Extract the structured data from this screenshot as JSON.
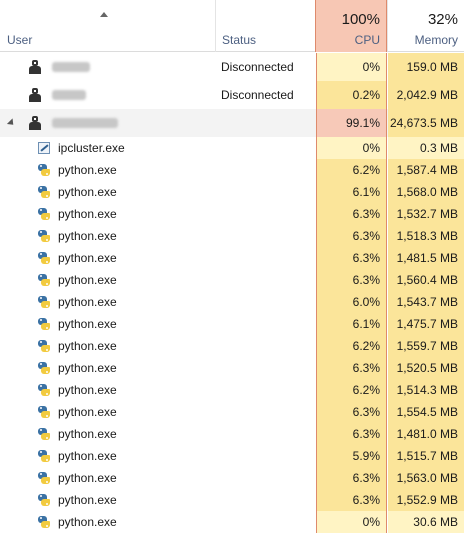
{
  "header": {
    "user_label": "User",
    "status_label": "Status",
    "cpu_pct": "100%",
    "cpu_label": "CPU",
    "mem_pct": "32%",
    "mem_label": "Memory"
  },
  "colors": {
    "cpu_header_bg": "#f7c7b4",
    "cpu_border": "#de8a6c",
    "heat_low": "#fff4c4",
    "heat_mid": "#fbe59a",
    "heat_high": "#f7c9b8",
    "header_label": "#4d6082"
  },
  "users": [
    {
      "name": "",
      "status": "Disconnected",
      "cpu": "0%",
      "memory": "159.0 MB",
      "blur_width": 38
    },
    {
      "name": "",
      "status": "Disconnected",
      "cpu": "0.2%",
      "memory": "2,042.9 MB",
      "blur_width": 34
    },
    {
      "name": "",
      "status": "",
      "cpu": "99.1%",
      "memory": "24,673.5 MB",
      "blur_width": 66
    }
  ],
  "processes": [
    {
      "icon": "ipcluster-icon",
      "name": "ipcluster.exe",
      "cpu": "0%",
      "memory": "0.3 MB"
    },
    {
      "icon": "python-icon",
      "name": "python.exe",
      "cpu": "6.2%",
      "memory": "1,587.4 MB"
    },
    {
      "icon": "python-icon",
      "name": "python.exe",
      "cpu": "6.1%",
      "memory": "1,568.0 MB"
    },
    {
      "icon": "python-icon",
      "name": "python.exe",
      "cpu": "6.3%",
      "memory": "1,532.7 MB"
    },
    {
      "icon": "python-icon",
      "name": "python.exe",
      "cpu": "6.3%",
      "memory": "1,518.3 MB"
    },
    {
      "icon": "python-icon",
      "name": "python.exe",
      "cpu": "6.3%",
      "memory": "1,481.5 MB"
    },
    {
      "icon": "python-icon",
      "name": "python.exe",
      "cpu": "6.3%",
      "memory": "1,560.4 MB"
    },
    {
      "icon": "python-icon",
      "name": "python.exe",
      "cpu": "6.0%",
      "memory": "1,543.7 MB"
    },
    {
      "icon": "python-icon",
      "name": "python.exe",
      "cpu": "6.1%",
      "memory": "1,475.7 MB"
    },
    {
      "icon": "python-icon",
      "name": "python.exe",
      "cpu": "6.2%",
      "memory": "1,559.7 MB"
    },
    {
      "icon": "python-icon",
      "name": "python.exe",
      "cpu": "6.3%",
      "memory": "1,520.5 MB"
    },
    {
      "icon": "python-icon",
      "name": "python.exe",
      "cpu": "6.2%",
      "memory": "1,514.3 MB"
    },
    {
      "icon": "python-icon",
      "name": "python.exe",
      "cpu": "6.3%",
      "memory": "1,554.5 MB"
    },
    {
      "icon": "python-icon",
      "name": "python.exe",
      "cpu": "6.3%",
      "memory": "1,481.0 MB"
    },
    {
      "icon": "python-icon",
      "name": "python.exe",
      "cpu": "5.9%",
      "memory": "1,515.7 MB"
    },
    {
      "icon": "python-icon",
      "name": "python.exe",
      "cpu": "6.3%",
      "memory": "1,563.0 MB"
    },
    {
      "icon": "python-icon",
      "name": "python.exe",
      "cpu": "6.3%",
      "memory": "1,552.9 MB"
    },
    {
      "icon": "python-icon",
      "name": "python.exe",
      "cpu": "0%",
      "memory": "30.6 MB"
    }
  ]
}
